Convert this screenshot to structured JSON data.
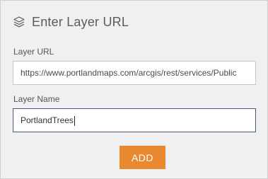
{
  "header": {
    "title": "Enter Layer URL",
    "icon": "layers-icon"
  },
  "form": {
    "url_label": "Layer URL",
    "url_value": "https://www.portlandmaps.com/arcgis/rest/services/Public",
    "name_label": "Layer Name",
    "name_value": "PortlandTrees",
    "add_label": "ADD"
  },
  "colors": {
    "panel_bg": "#f0f0f0",
    "accent": "#e9892f",
    "focus_border": "#465e80"
  }
}
